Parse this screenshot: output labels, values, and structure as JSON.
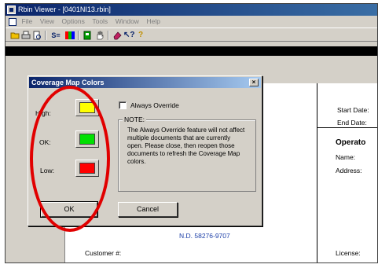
{
  "window": {
    "title": "Rbin Viewer - [0401NI13.rbin]"
  },
  "menu": [
    "File",
    "View",
    "Options",
    "Tools",
    "Window",
    "Help"
  ],
  "toolbar": {
    "icons": [
      "open-icon",
      "print-icon",
      "print-preview-icon",
      "summary-icon",
      "map-icon",
      "page-icon",
      "hand-icon",
      "eraser-icon",
      "help-pointer-icon",
      "help-icon"
    ]
  },
  "dialog": {
    "title": "Coverage Map Colors",
    "close": "×",
    "high_label": "High:",
    "ok_label": "OK:",
    "low_label": "Low:",
    "high_color": "#ffff00",
    "ok_color": "#00e000",
    "low_color": "#ff0000",
    "checkbox_label": "Always Override",
    "checkbox_checked": false,
    "note_title": "NOTE:",
    "note_text": "The Always Override feature will not affect multiple documents that are currently open.  Please close, then reopen those documents to refresh the Coverage Map colors.",
    "ok_button": "OK",
    "cancel_button": "Cancel"
  },
  "document": {
    "start_date": "Start Date:",
    "end_date": "End Date:",
    "operator": "Operato",
    "name": "Name:",
    "address": "Address:",
    "license": "License:",
    "customer": "Customer #:",
    "nd_number": "N.D. 58276-9707"
  },
  "annotation_color": "#e10000"
}
